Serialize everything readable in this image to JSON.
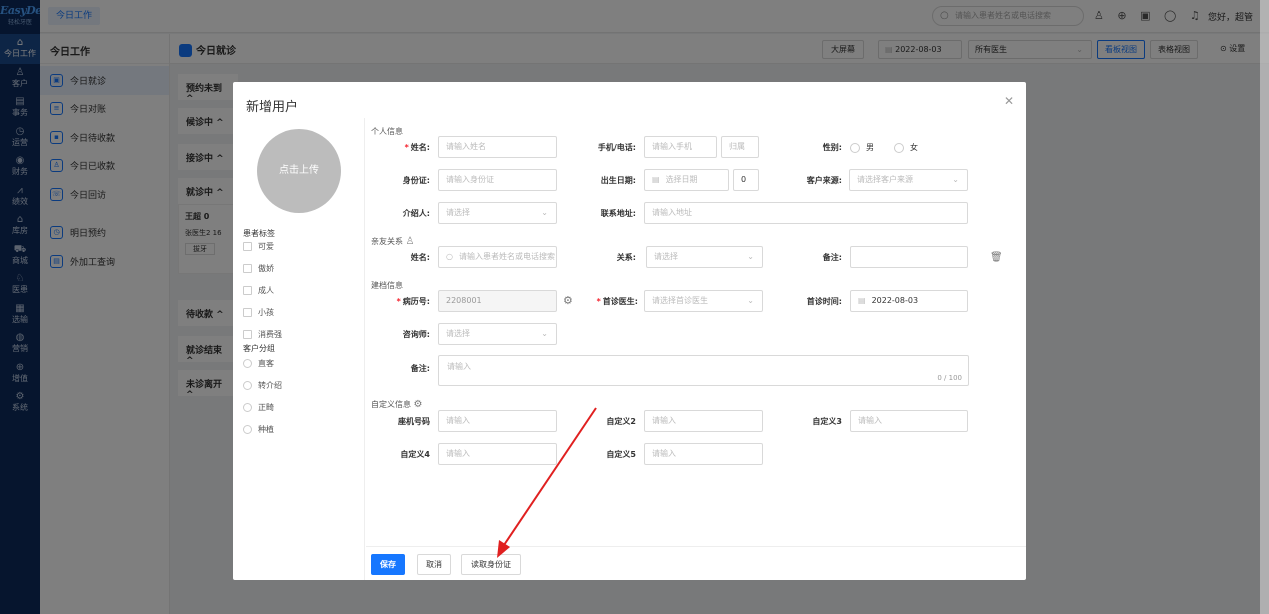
{
  "app": {
    "logo": "EasyDent",
    "logo_sub": "轻松牙医",
    "tab": "今日工作"
  },
  "nav": [
    {
      "icon": "home-icon",
      "glyph": "⌂",
      "label": "今日工作"
    },
    {
      "icon": "user-icon",
      "glyph": "♙",
      "label": "客户"
    },
    {
      "icon": "task-icon",
      "glyph": "▤",
      "label": "事务"
    },
    {
      "icon": "clock-icon",
      "glyph": "◷",
      "label": "运营"
    },
    {
      "icon": "money-icon",
      "glyph": "◉",
      "label": "财务"
    },
    {
      "icon": "chart-icon",
      "glyph": "⩘",
      "label": "绩效"
    },
    {
      "icon": "warehouse-icon",
      "glyph": "⌂",
      "label": "库房"
    },
    {
      "icon": "cart-icon",
      "glyph": "⛟",
      "label": "商城"
    },
    {
      "icon": "doctor-icon",
      "glyph": "♘",
      "label": "医患"
    },
    {
      "icon": "lab-icon",
      "glyph": "▦",
      "label": "选输"
    },
    {
      "icon": "marketing-icon",
      "glyph": "◍",
      "label": "营销"
    },
    {
      "icon": "plus-value-icon",
      "glyph": "⊕",
      "label": "增值"
    },
    {
      "icon": "system-icon",
      "glyph": "⚙",
      "label": "系统"
    }
  ],
  "topbar": {
    "search_placeholder": "请输入患者姓名或电话搜索",
    "greeting": "您好，超管"
  },
  "sidebar": {
    "title": "今日工作",
    "items": [
      {
        "label": "今日就诊"
      },
      {
        "label": "今日对账"
      },
      {
        "label": "今日待收款"
      },
      {
        "label": "今日已收款"
      },
      {
        "label": "今日回访"
      }
    ],
    "items2": [
      {
        "label": "明日预约"
      },
      {
        "label": "外加工查询"
      }
    ]
  },
  "main": {
    "title": "今日就诊",
    "btn_bigscreen": "大屏幕",
    "date": "2022-08-03",
    "doctor_select": "所有医生",
    "btn_board": "看板视图",
    "btn_table": "表格视图",
    "settings": "设置",
    "lanes": [
      "预约未到 ^",
      "候诊中 ^",
      "接诊中 ^",
      "就诊中 ^",
      "待收款 ^",
      "就诊结束 ^",
      "未诊离开 ^"
    ],
    "card": {
      "name": "王超 0",
      "doctor": "张医生2 16",
      "tag": "拔牙"
    }
  },
  "modal": {
    "title": "新增用户",
    "avatar": "点击上传",
    "tags_title": "患者标签",
    "tags": [
      "可爱",
      "傲娇",
      "成人",
      "小孩",
      "消费强"
    ],
    "groups_title": "客户分组",
    "groups": [
      "直客",
      "转介绍",
      "正畸",
      "种植"
    ],
    "sections": {
      "personal": "个人信息",
      "relatives": "亲友关系",
      "record": "建档信息",
      "custom": "自定义信息"
    },
    "fields": {
      "name": {
        "label": "姓名:",
        "ph": "请输入姓名"
      },
      "phone": {
        "label": "手机/电话:",
        "ph": "请输入手机",
        "ph2": "归属"
      },
      "gender": {
        "label": "性别:",
        "male": "男",
        "female": "女"
      },
      "idcard": {
        "label": "身份证:",
        "ph": "请输入身份证"
      },
      "birth": {
        "label": "出生日期:",
        "ph": "选择日期",
        "age": "0"
      },
      "source": {
        "label": "客户来源:",
        "ph": "请选择客户来源"
      },
      "referrer": {
        "label": "介绍人:",
        "ph": "请选择"
      },
      "address": {
        "label": "联系地址:",
        "ph": "请输入地址"
      },
      "rel_name": {
        "label": "姓名:",
        "ph": "请输入患者姓名或电话搜索"
      },
      "relation": {
        "label": "关系:",
        "ph": "请选择"
      },
      "rel_note": {
        "label": "备注:"
      },
      "record_no": {
        "label": "病历号:",
        "value": "2208001"
      },
      "first_doctor": {
        "label": "首诊医生:",
        "ph": "请选择首诊医生"
      },
      "first_time": {
        "label": "首诊时间:",
        "value": "2022-08-03"
      },
      "consultant": {
        "label": "咨询师:",
        "ph": "请选择"
      },
      "note": {
        "label": "备注:",
        "ph": "请输入",
        "count": "0 / 100"
      },
      "landline": {
        "label": "座机号码",
        "ph": "请输入"
      },
      "c2": {
        "label": "自定义2",
        "ph": "请输入"
      },
      "c3": {
        "label": "自定义3",
        "ph": "请输入"
      },
      "c4": {
        "label": "自定义4",
        "ph": "请输入"
      },
      "c5": {
        "label": "自定义5",
        "ph": "请输入"
      }
    },
    "footer": {
      "save": "保存",
      "cancel": "取消",
      "read_id": "读取身份证"
    }
  },
  "colors": {
    "primary": "#1677ff",
    "nav_bg": "#0c2a5c",
    "annotation": "#e02020"
  }
}
